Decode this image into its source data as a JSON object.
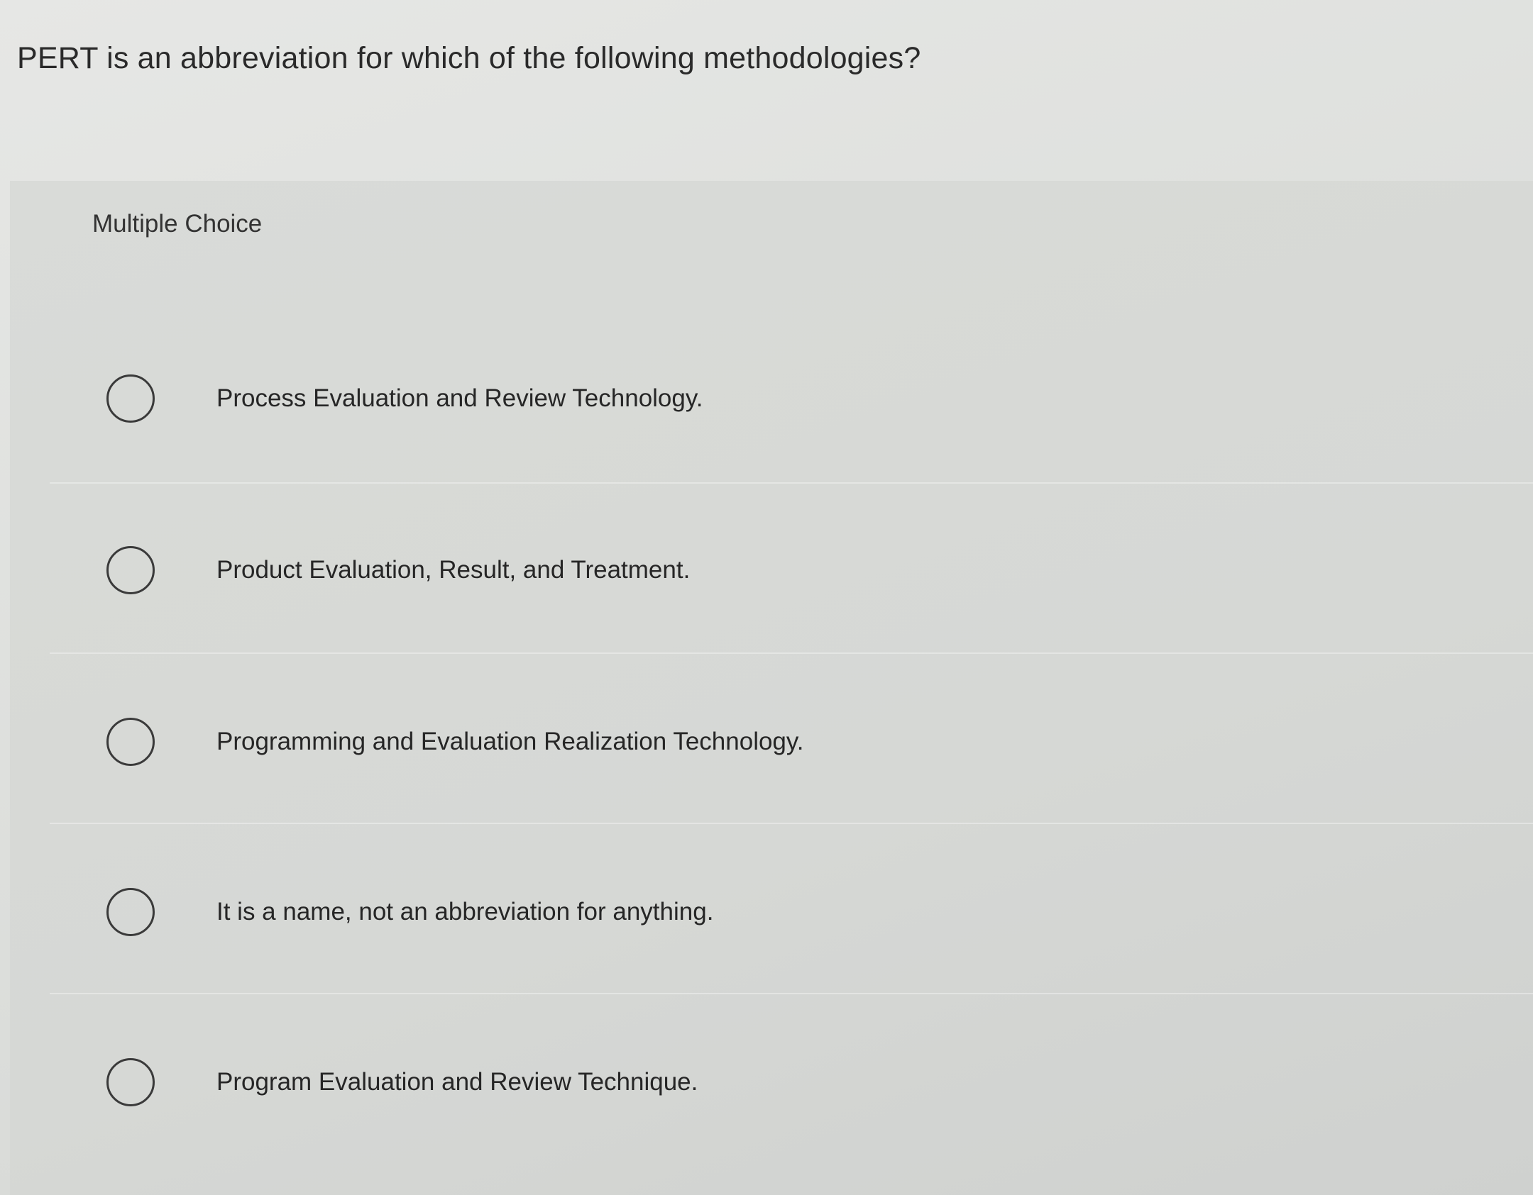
{
  "question": {
    "text": "PERT is an abbreviation for which of the following methodologies?"
  },
  "question_type": "Multiple Choice",
  "options": [
    {
      "label": "Process Evaluation and Review Technology.",
      "selected": false
    },
    {
      "label": "Product Evaluation, Result, and Treatment.",
      "selected": false
    },
    {
      "label": "Programming and Evaluation Realization Technology.",
      "selected": false
    },
    {
      "label": "It is a name, not an abbreviation for anything.",
      "selected": false
    },
    {
      "label": "Program Evaluation and Review Technique.",
      "selected": false
    }
  ]
}
